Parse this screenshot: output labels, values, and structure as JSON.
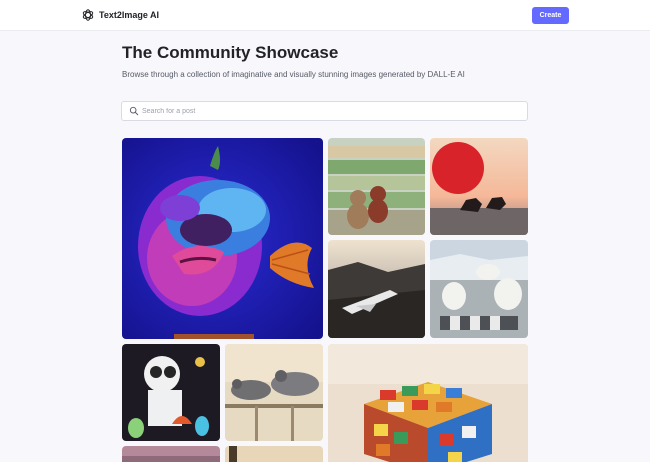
{
  "app": {
    "name": "Text2Image AI"
  },
  "header": {
    "create_label": "Create"
  },
  "hero": {
    "title": "The Community Showcase",
    "subtitle": "Browse through a collection of imaginative and visually stunning images generated by DALL-E AI"
  },
  "search": {
    "placeholder": "Search for a post",
    "value": ""
  },
  "colors": {
    "accent": "#6469ff",
    "background": "#f8f8fc",
    "text": "#222328"
  },
  "icons": {
    "logo": "openai-logo-icon",
    "search": "search-icon"
  }
}
